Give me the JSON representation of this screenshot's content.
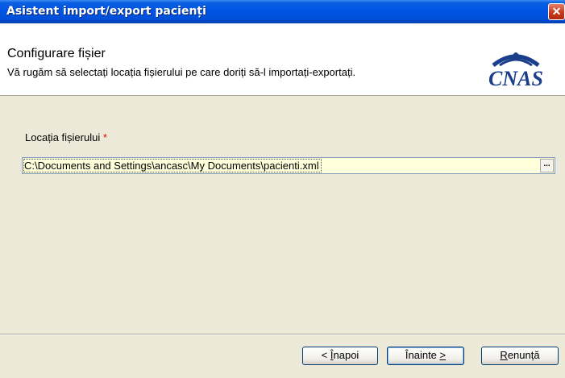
{
  "window": {
    "title": "Asistent import/export pacienți"
  },
  "header": {
    "title": "Configurare fișier",
    "subtitle": "Vă rugăm să selectați locația fișierului pe care doriți să-l importați-exportați.",
    "logo_text": "CNAS"
  },
  "form": {
    "label": "Locația fișierului",
    "required_mark": "*",
    "path_value": "C:\\Documents and Settings\\ancasc\\My Documents\\pacienti.xml",
    "browse_label": "..."
  },
  "buttons": {
    "back_mnemonic": "Î",
    "back_rest": "napoi",
    "back_prefix": "< ",
    "next_text": "Înainte ",
    "next_arrow": ">",
    "cancel_mnemonic": "R",
    "cancel_rest": "enunță"
  },
  "colors": {
    "titlebar": "#0054e3",
    "background": "#ece9d8",
    "input_bg": "#ffffdc",
    "logo_blue": "#1a3e8c"
  }
}
